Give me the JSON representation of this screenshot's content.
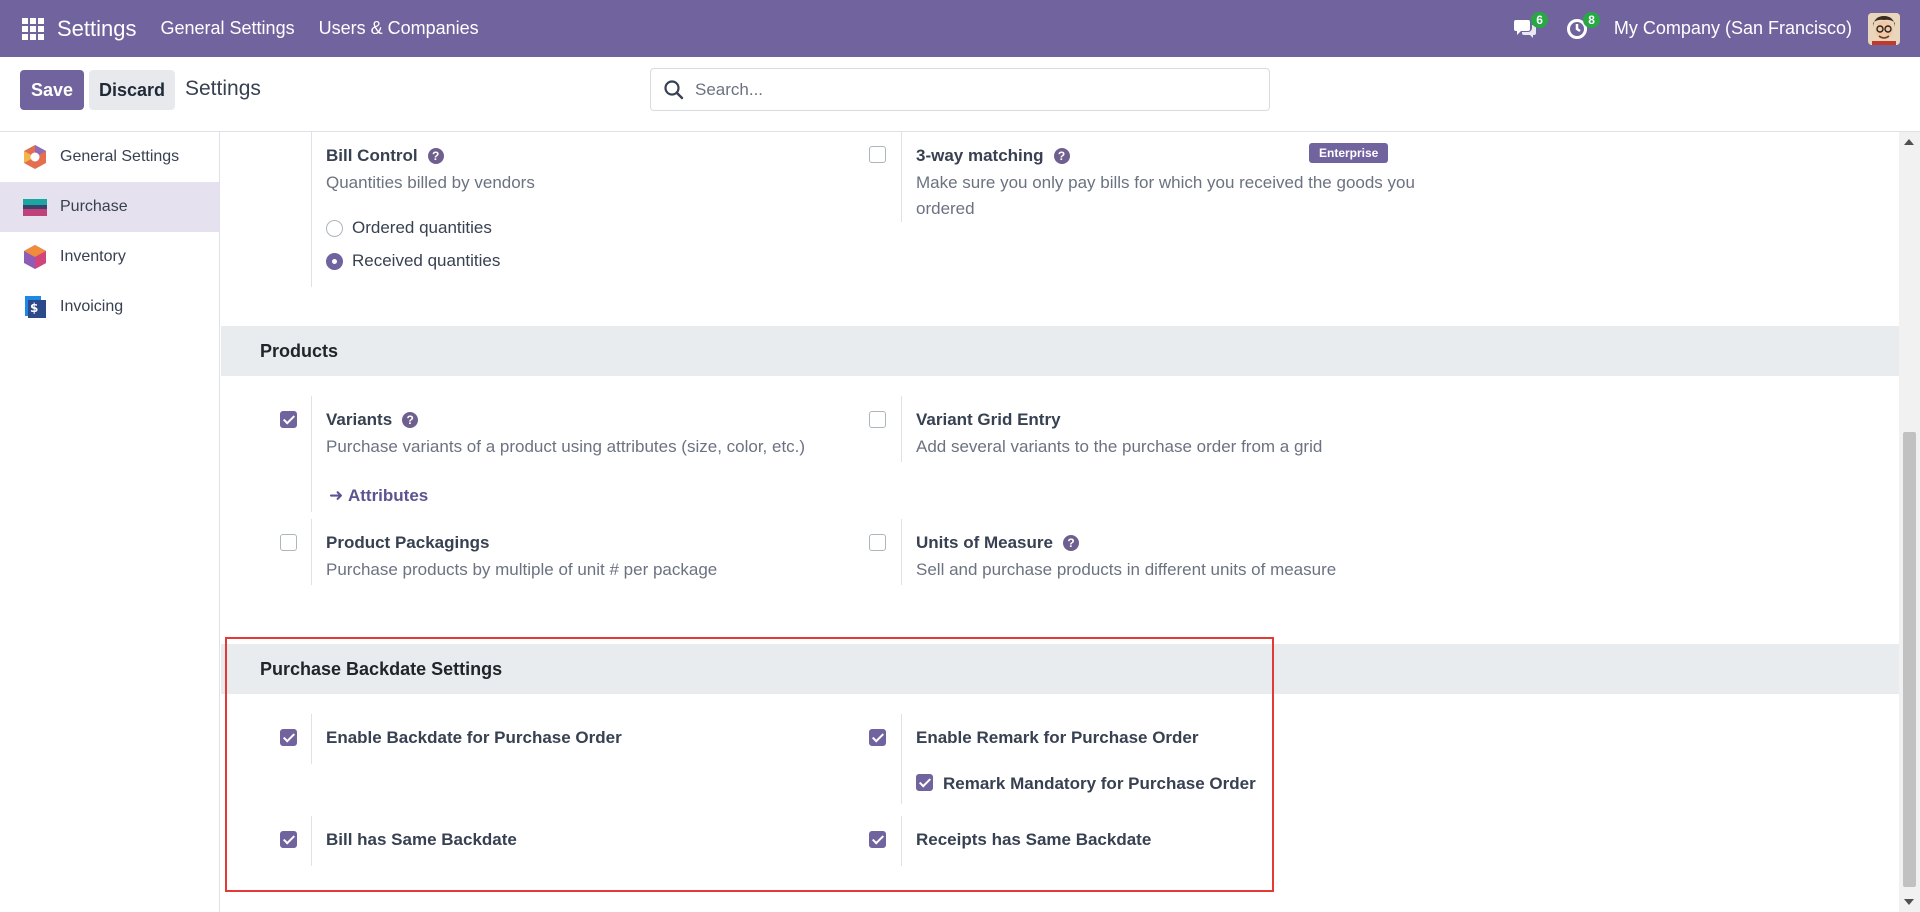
{
  "topnav": {
    "brand": "Settings",
    "menu": [
      "General Settings",
      "Users & Companies"
    ],
    "messages_badge": "6",
    "activities_badge": "8",
    "company": "My Company (San Francisco)"
  },
  "controlbar": {
    "save_label": "Save",
    "discard_label": "Discard",
    "title": "Settings",
    "search_placeholder": "Search..."
  },
  "sidebar": {
    "items": [
      {
        "label": "General Settings",
        "active": false
      },
      {
        "label": "Purchase",
        "active": true
      },
      {
        "label": "Inventory",
        "active": false
      },
      {
        "label": "Invoicing",
        "active": false
      }
    ]
  },
  "bill_control": {
    "title": "Bill Control",
    "desc": "Quantities billed by vendors",
    "options": [
      "Ordered quantities",
      "Received quantities"
    ],
    "selected": "Received quantities"
  },
  "three_way": {
    "title": "3-way matching",
    "desc": "Make sure you only pay bills for which you received the goods you ordered",
    "badge": "Enterprise",
    "checked": false
  },
  "products_section": {
    "title": "Products",
    "variants": {
      "title": "Variants",
      "desc": "Purchase variants of a product using attributes (size, color, etc.)",
      "link": "Attributes",
      "checked": true
    },
    "variant_grid": {
      "title": "Variant Grid Entry",
      "desc": "Add several variants to the purchase order from a grid",
      "checked": false
    },
    "packagings": {
      "title": "Product Packagings",
      "desc": "Purchase products by multiple of unit # per package",
      "checked": false
    },
    "uom": {
      "title": "Units of Measure",
      "desc": "Sell and purchase products in different units of measure",
      "checked": false
    }
  },
  "backdate_section": {
    "title": "Purchase Backdate Settings",
    "enable_backdate": {
      "title": "Enable Backdate for Purchase Order",
      "checked": true
    },
    "enable_remark": {
      "title": "Enable Remark for Purchase Order",
      "checked": true
    },
    "remark_mandatory": {
      "title": "Remark Mandatory for Purchase Order",
      "checked": true
    },
    "bill_same": {
      "title": "Bill has Same Backdate",
      "checked": true
    },
    "receipts_same": {
      "title": "Receipts has Same Backdate",
      "checked": true
    }
  },
  "colors": {
    "brand": "#71639e",
    "highlight": "#e53935",
    "badge": "#28a745"
  }
}
